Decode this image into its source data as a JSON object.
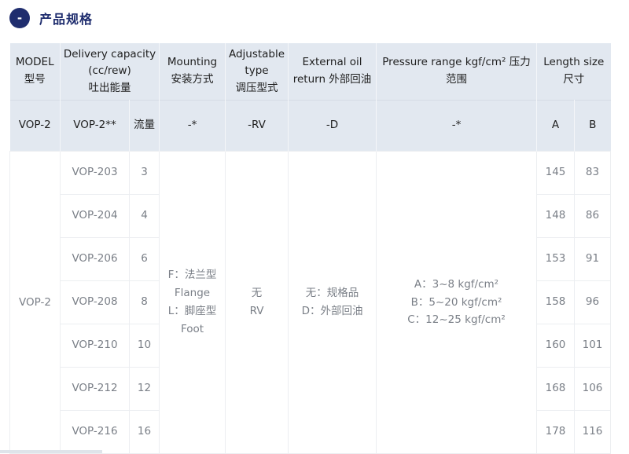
{
  "section": {
    "badge": "-",
    "title": "产品规格"
  },
  "header": {
    "model": [
      "MODEL",
      "型号"
    ],
    "delivery": [
      "Delivery capacity",
      "(cc/rew)",
      "吐出能量"
    ],
    "mounting": [
      "Mounting",
      "安装方式"
    ],
    "adjustable": [
      "Adjustable",
      "type",
      "调压型式"
    ],
    "external": [
      "External oil",
      "return 外部回油"
    ],
    "pressure": [
      "Pressure range kgf/cm² 压力",
      "范围"
    ],
    "length": [
      "Length size",
      "尺寸"
    ]
  },
  "code_row": {
    "model": "VOP-2",
    "delivery_code": "VOP-2**",
    "flow": "流量",
    "mounting": "-*",
    "adjustable": "-RV",
    "external": "-D",
    "pressure": "-*",
    "a": "A",
    "b": "B"
  },
  "body": {
    "model": "VOP-2",
    "mounting": [
      "F：法兰型",
      "Flange",
      "L：脚座型",
      "Foot"
    ],
    "adjustable": [
      "无",
      "RV"
    ],
    "external": [
      "无：规格品",
      "D：外部回油"
    ],
    "pressure": [
      "A：3~8 kgf/cm²",
      "B：5~20 kgf/cm²",
      "C：12~25 kgf/cm²"
    ]
  },
  "rows": [
    {
      "code": "VOP-203",
      "flow": "3",
      "a": "145",
      "b": "83"
    },
    {
      "code": "VOP-204",
      "flow": "4",
      "a": "148",
      "b": "86"
    },
    {
      "code": "VOP-206",
      "flow": "6",
      "a": "153",
      "b": "91"
    },
    {
      "code": "VOP-208",
      "flow": "8",
      "a": "158",
      "b": "96"
    },
    {
      "code": "VOP-210",
      "flow": "10",
      "a": "160",
      "b": "101"
    },
    {
      "code": "VOP-212",
      "flow": "12",
      "a": "168",
      "b": "106"
    },
    {
      "code": "VOP-216",
      "flow": "16",
      "a": "178",
      "b": "116"
    }
  ]
}
